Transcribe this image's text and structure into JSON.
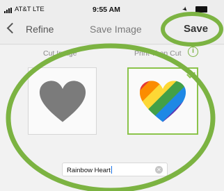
{
  "status": {
    "carrier": "AT&T LTE",
    "time": "9:55 AM"
  },
  "nav": {
    "back_label": "Refine",
    "title": "Save Image",
    "save_label": "Save"
  },
  "options": {
    "cut": {
      "label": "Cut Image",
      "icon": "gray-heart-icon",
      "selected": false
    },
    "print": {
      "label": "Print Then Cut",
      "icon": "rainbow-heart-icon",
      "selected": true
    }
  },
  "name_field": {
    "value": "Rainbow Heart"
  },
  "colors": {
    "accent_green": "#8bc34a",
    "annotation_green": "#7cb342",
    "heart_gray": "#7b7b7b",
    "rainbow": [
      "#e53935",
      "#fb8c00",
      "#fdd835",
      "#43a047",
      "#1e88e5",
      "#5e35b1",
      "#8e24aa"
    ]
  }
}
